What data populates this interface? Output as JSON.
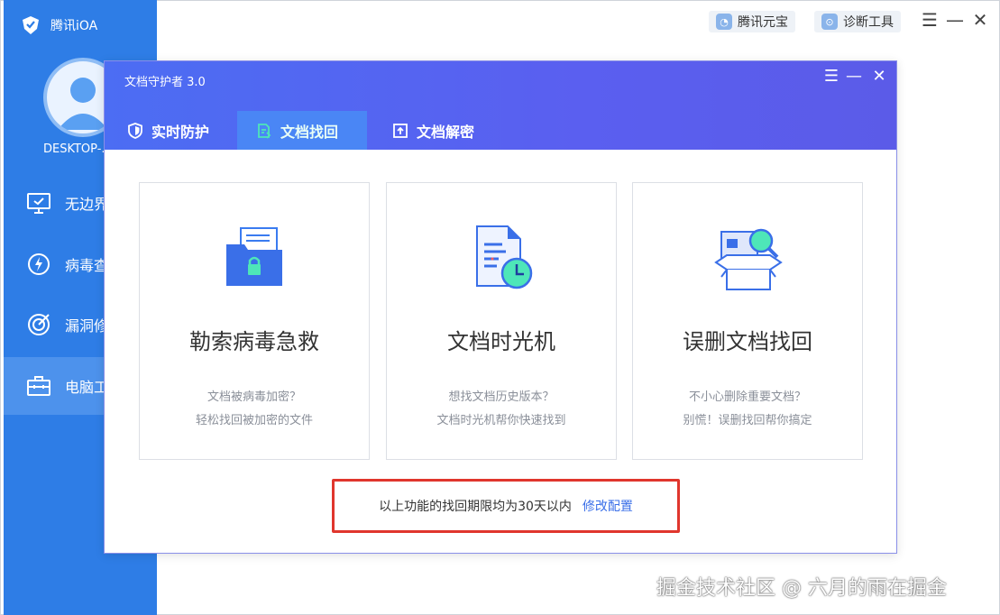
{
  "app": {
    "brand": "腾讯iOA",
    "hostname": "DESKTOP-.",
    "nav": [
      {
        "label": "无边界",
        "icon": "monitor-check-icon"
      },
      {
        "label": "病毒查",
        "icon": "virus-scan-icon"
      },
      {
        "label": "漏洞修",
        "icon": "vulnerability-fix-icon"
      },
      {
        "label": "电脑工",
        "icon": "toolbox-icon"
      }
    ],
    "top_buttons": [
      {
        "label": "腾讯元宝",
        "icon": "yuanbao-icon"
      },
      {
        "label": "诊断工具",
        "icon": "diagnostic-icon"
      }
    ]
  },
  "modal": {
    "title": "文档守护者 3.0",
    "tabs": [
      {
        "label": "实时防护",
        "icon": "shield-icon"
      },
      {
        "label": "文档找回",
        "icon": "document-recover-icon"
      },
      {
        "label": "文档解密",
        "icon": "document-decrypt-icon"
      }
    ],
    "cards": [
      {
        "title": "勒索病毒急救",
        "line1": "文档被病毒加密？",
        "line2": "轻松找回被加密的文件",
        "icon": "locked-folder-icon"
      },
      {
        "title": "文档时光机",
        "line1": "想找文档历史版本？",
        "line2": "文档时光机帮你快速找到",
        "icon": "document-clock-icon"
      },
      {
        "title": "误删文档找回",
        "line1": "不小心删除重要文档？",
        "line2": "别慌！误删找回帮你搞定",
        "icon": "box-search-icon"
      }
    ],
    "notice": {
      "text": "以上功能的找回期限均为30天以内",
      "link": "修改配置"
    }
  },
  "watermark": "掘金技术社区 @ 六月的雨在掘金",
  "colors": {
    "sidebar": "#2e7de6",
    "header_gradient_start": "#4c6df3",
    "header_gradient_end": "#5b5be8",
    "active_tab": "#4a86f5",
    "highlight_border": "#e0362d",
    "link": "#3a6fe8"
  }
}
